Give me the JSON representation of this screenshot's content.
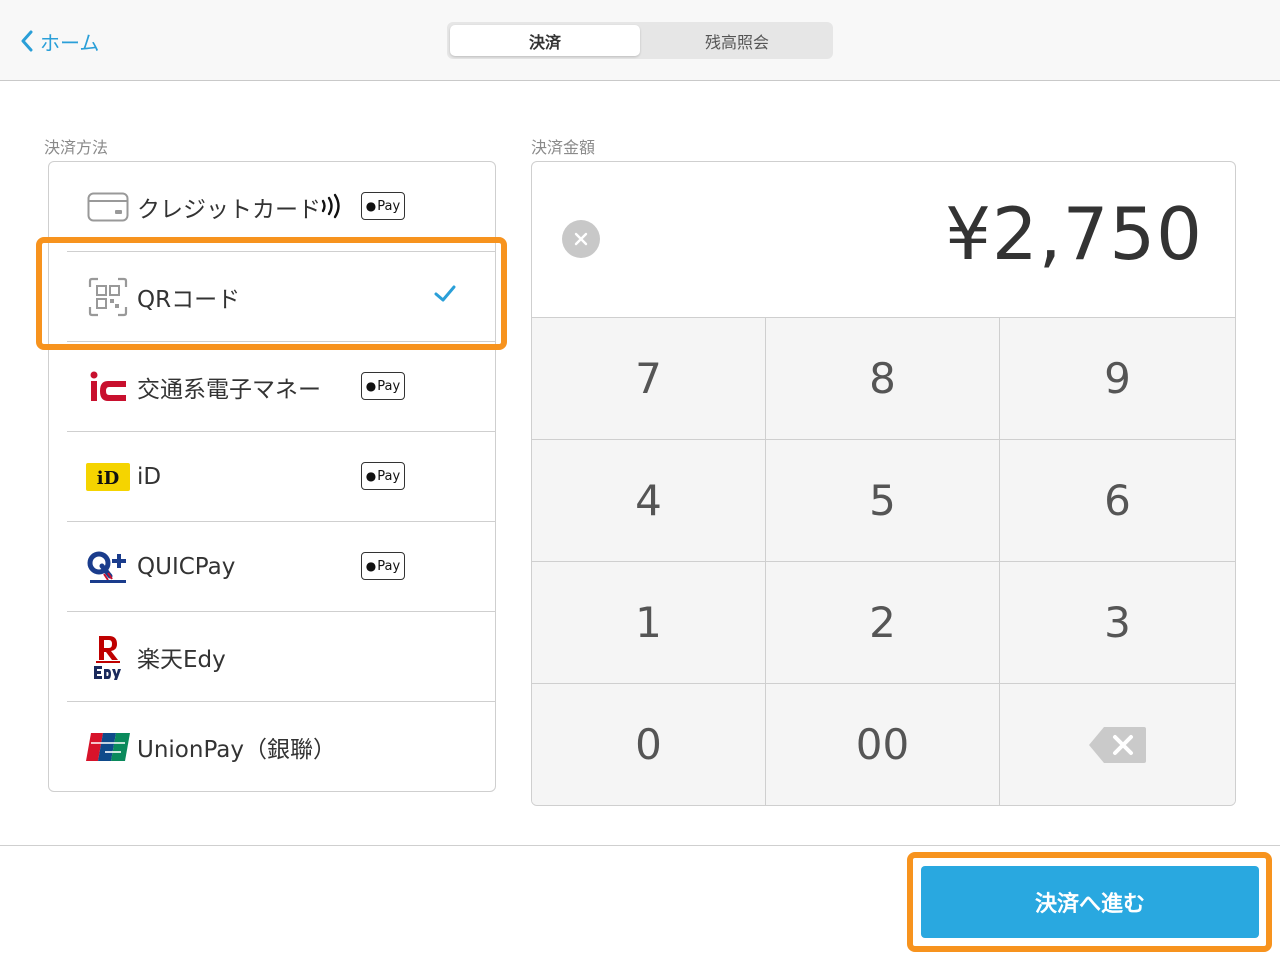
{
  "header": {
    "back_label": "ホーム",
    "tabs": [
      {
        "label": "決済",
        "active": true
      },
      {
        "label": "残高照会",
        "active": false
      }
    ]
  },
  "methods_section": {
    "label": "決済方法",
    "items": [
      {
        "label": "クレジットカード",
        "icon": "credit-card-icon",
        "contactless": true,
        "apple_pay": true,
        "apple_pay_label": "Pay"
      },
      {
        "label": "QRコード",
        "icon": "qr-code-icon",
        "selected": true
      },
      {
        "label": "交通系電子マネー",
        "icon": "transit-ic-icon",
        "apple_pay": true,
        "apple_pay_label": "Pay"
      },
      {
        "label": "iD",
        "icon": "id-logo-icon",
        "apple_pay": true,
        "apple_pay_label": "Pay"
      },
      {
        "label": "QUICPay",
        "icon": "quicpay-logo-icon",
        "apple_pay": true,
        "apple_pay_label": "Pay"
      },
      {
        "label": "楽天Edy",
        "icon": "rakuten-edy-logo-icon"
      },
      {
        "label": "UnionPay（銀聯）",
        "icon": "unionpay-logo-icon"
      }
    ]
  },
  "amount_section": {
    "label": "決済金額",
    "amount": "¥2,750"
  },
  "keypad": {
    "keys": [
      "7",
      "8",
      "9",
      "4",
      "5",
      "6",
      "1",
      "2",
      "3",
      "0",
      "00",
      ""
    ]
  },
  "footer": {
    "proceed_label": "決済へ進む"
  },
  "colors": {
    "accent": "#29a8e0",
    "highlight": "#f7931e"
  }
}
